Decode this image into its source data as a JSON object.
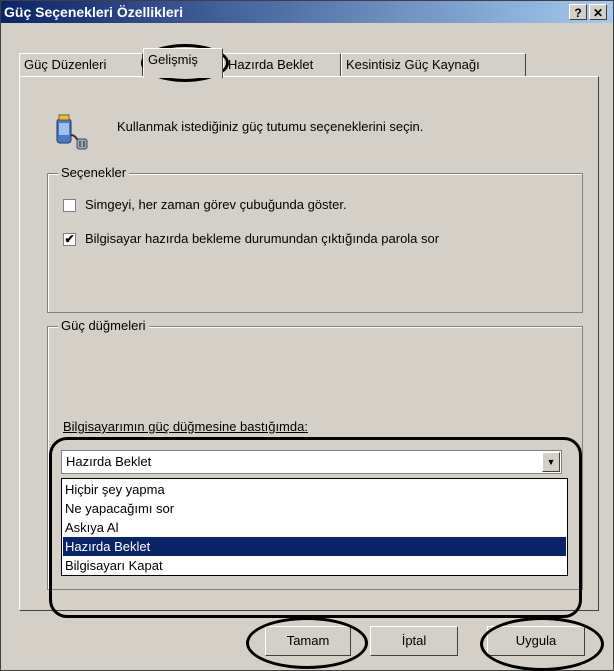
{
  "window": {
    "title": "Güç Seçenekleri Özellikleri",
    "help_button": "?",
    "close_button": "✕"
  },
  "tabs": [
    {
      "label": "Güç Düzenleri",
      "active": false
    },
    {
      "label": "Gelişmiş",
      "active": true
    },
    {
      "label": "Hazırda Beklet",
      "active": false
    },
    {
      "label": "Kesintisiz Güç Kaynağı",
      "active": false
    }
  ],
  "intro": {
    "text": "Kullanmak istediğiniz güç tutumu seçeneklerini seçin.",
    "icon": "power-plug-battery-icon"
  },
  "options_group": {
    "title": "Seçenekler",
    "checkboxes": [
      {
        "label": "Simgeyi, her zaman görev çubuğunda göster.",
        "checked": false
      },
      {
        "label": "Bilgisayar hazırda bekleme durumundan çıktığında parola sor",
        "checked": true
      }
    ]
  },
  "power_buttons_group": {
    "title": "Güç düğmeleri",
    "power_button_label": "Bilgisayarımın güç düğmesine bastığımda:",
    "selected": "Hazırda Beklet",
    "options": [
      "Hiçbir şey yapma",
      "Ne yapacağımı sor",
      "Askıya Al",
      "Hazırda Beklet",
      "Bilgisayarı Kapat"
    ],
    "selected_index": 3
  },
  "buttons": {
    "ok": "Tamam",
    "cancel": "İptal",
    "apply": "Uygula"
  },
  "colors": {
    "titlebar": "#0a246a",
    "selection": "#0a246a",
    "face": "#d4d0c8"
  }
}
